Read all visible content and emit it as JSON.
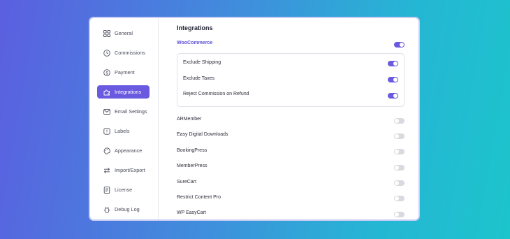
{
  "sidebar": {
    "items": [
      {
        "label": "General",
        "icon": "grid-icon"
      },
      {
        "label": "Commissions",
        "icon": "clock-icon"
      },
      {
        "label": "Payment",
        "icon": "dollar-icon"
      },
      {
        "label": "Integrations",
        "icon": "puzzle-icon",
        "active": true
      },
      {
        "label": "Email Settings",
        "icon": "mail-icon"
      },
      {
        "label": "Labels",
        "icon": "tag-icon"
      },
      {
        "label": "Appearance",
        "icon": "palette-icon"
      },
      {
        "label": "Import/Export",
        "icon": "swap-icon"
      },
      {
        "label": "License",
        "icon": "license-icon"
      },
      {
        "label": "Debug Log",
        "icon": "bug-icon"
      }
    ]
  },
  "main": {
    "title": "Integrations",
    "woocommerce": {
      "label": "WooCommerce",
      "enabled": true,
      "options": [
        {
          "label": "Exclude Shipping",
          "enabled": true
        },
        {
          "label": "Exclude Taxes",
          "enabled": true
        },
        {
          "label": "Reject Commission on Refund",
          "enabled": true
        }
      ]
    },
    "integrations": [
      {
        "label": "ARMember",
        "enabled": false
      },
      {
        "label": "Easy Digital Downloads",
        "enabled": false
      },
      {
        "label": "BookingPress",
        "enabled": false
      },
      {
        "label": "MemberPress",
        "enabled": false
      },
      {
        "label": "SureCart",
        "enabled": false
      },
      {
        "label": "Restrict Content Pro",
        "enabled": false
      },
      {
        "label": "WP EasyCart",
        "enabled": false
      }
    ]
  },
  "colors": {
    "accent": "#6a5ae0",
    "toggle_off": "#d8dae0",
    "active_text": "#ffffff"
  }
}
